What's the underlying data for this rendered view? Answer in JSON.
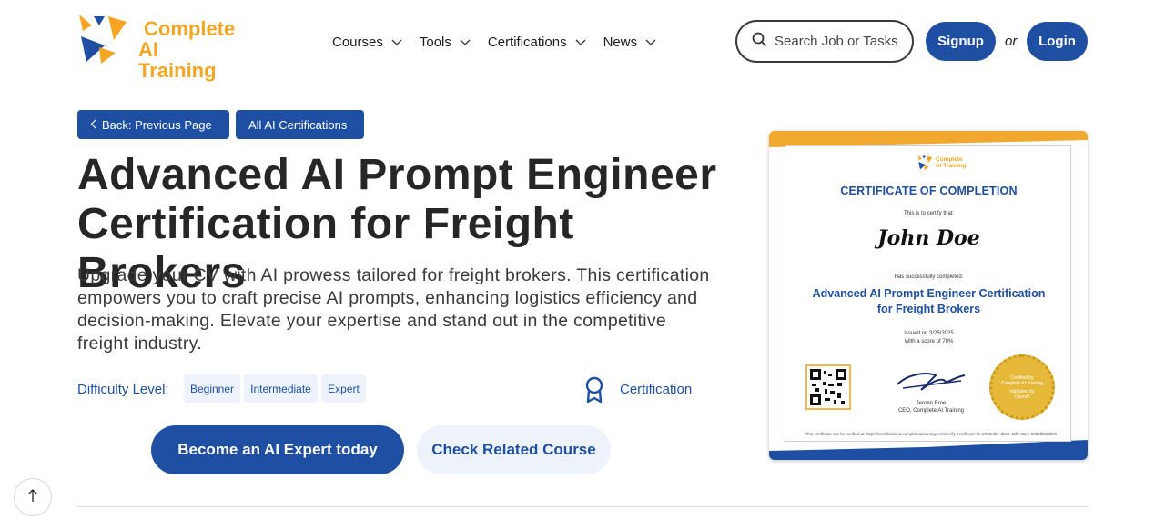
{
  "header": {
    "logo_line1": "Complete",
    "logo_line2": "AI Training",
    "nav": [
      {
        "label": "Courses"
      },
      {
        "label": "Tools"
      },
      {
        "label": "Certifications"
      },
      {
        "label": "News"
      }
    ],
    "search_placeholder": "Search Job or Tasks",
    "signup": "Signup",
    "or": "or",
    "login": "Login"
  },
  "breadcrumbs": {
    "back": "Back: Previous Page",
    "all": "All AI Certifications"
  },
  "main": {
    "title": "Advanced AI Prompt Engineer Certification for Freight Brokers",
    "description": "Upgrade your CV with AI prowess tailored for freight brokers. This certification empowers you to craft precise AI prompts, enhancing logistics efficiency and decision-making. Elevate your expertise and stand out in the competitive freight industry.",
    "difficulty_label": "Difficulty Level:",
    "levels": [
      "Beginner",
      "Intermediate",
      "Expert"
    ],
    "type_label": "Certification",
    "cta_primary": "Become an AI Expert today",
    "cta_secondary": "Check Related Course"
  },
  "certificate": {
    "logo_line1": "Complete",
    "logo_line2": "AI Training",
    "heading": "CERTIFICATE OF COMPLETION",
    "certify_text": "This is to certify that:",
    "name": "John Doe",
    "completed_text": "Has successfully completed:",
    "course": "Advanced AI Prompt Engineer Certification for Freight Brokers",
    "issued": "Issued on 3/25/2025",
    "score": "With a score of 78%",
    "signer_name": "Jeroen Erne",
    "signer_title": "CEO, Complete AI Training",
    "seal_line1": "Certified by",
    "seal_line2": "Complete AI Training",
    "seal_line3": "Validated by",
    "seal_line4": "OpenAI",
    "verify": "This certificate can be verified at: https://certifications.completeaitraining.com/verify-certificate?id=6720af9e-d229-42f5-98e2-8084f8b8d296"
  },
  "colors": {
    "brand_blue": "#1f4fa3",
    "brand_orange": "#f5a524",
    "chip_bg": "#eef3fb"
  }
}
